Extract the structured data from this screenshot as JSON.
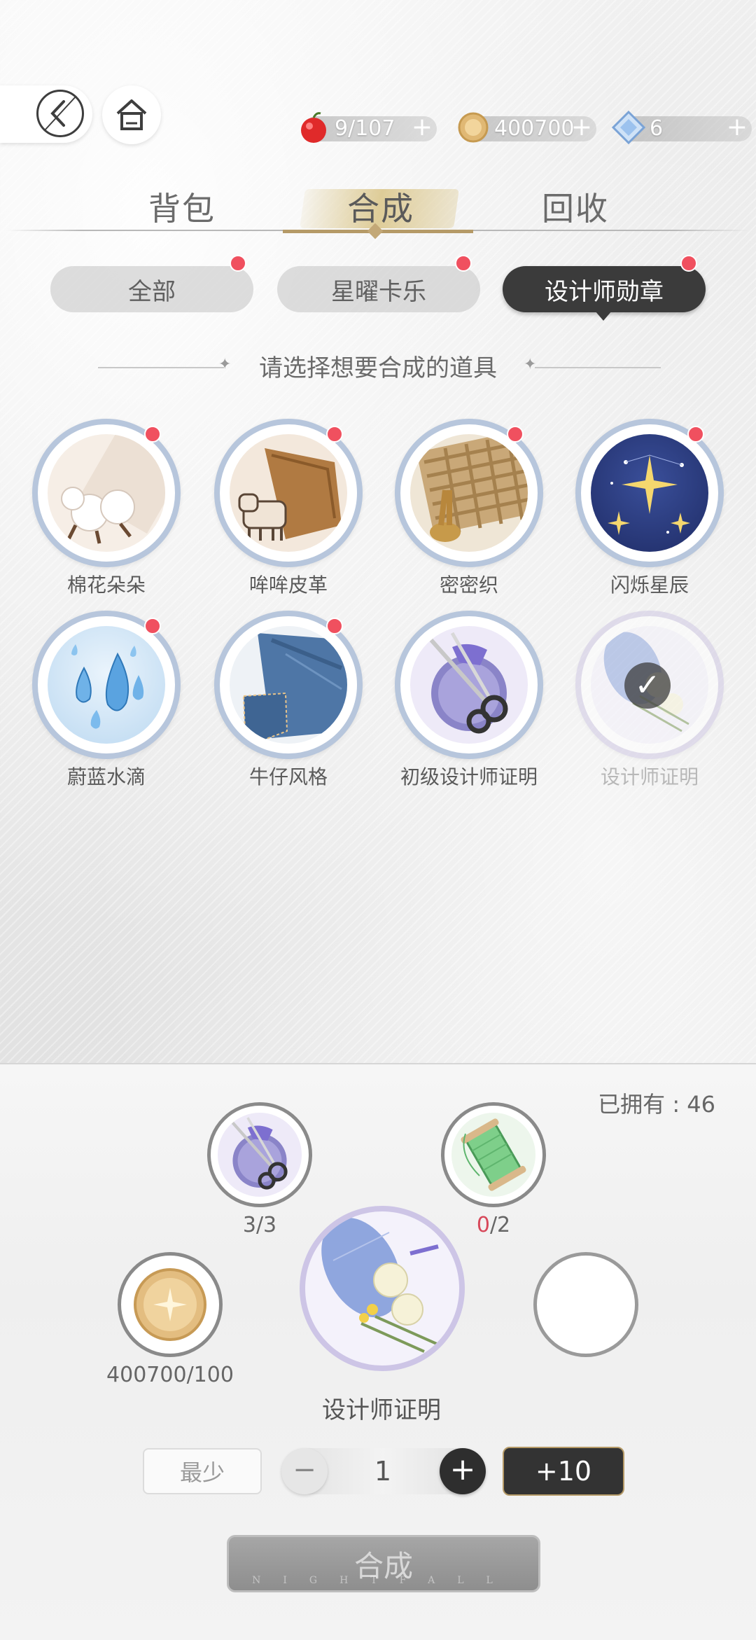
{
  "topbar": {
    "back_label": "",
    "resources": [
      {
        "name": "apple",
        "value": "9/107",
        "plus": "+"
      },
      {
        "name": "coin",
        "value": "400700",
        "plus": "+"
      },
      {
        "name": "diamond",
        "value": "6",
        "plus": "+"
      }
    ]
  },
  "tabs": [
    {
      "label": "背包",
      "active": false
    },
    {
      "label": "合成",
      "active": true
    },
    {
      "label": "回收",
      "active": false
    }
  ],
  "subtabs": [
    {
      "label": "全部",
      "active": false,
      "badge": true
    },
    {
      "label": "星曜卡乐",
      "active": false,
      "badge": true
    },
    {
      "label": "设计师勋章",
      "active": true,
      "badge": true
    }
  ],
  "prompt": "请选择想要合成的道具",
  "items": [
    {
      "label": "棉花朵朵",
      "icon": "cotton-icon",
      "badge": true,
      "selected": false
    },
    {
      "label": "哞哞皮革",
      "icon": "leather-icon",
      "badge": true,
      "selected": false
    },
    {
      "label": "密密织",
      "icon": "weave-icon",
      "badge": true,
      "selected": false
    },
    {
      "label": "闪烁星辰",
      "icon": "stars-icon",
      "badge": true,
      "selected": false
    },
    {
      "label": "蔚蓝水滴",
      "icon": "waterdrop-icon",
      "badge": true,
      "selected": false
    },
    {
      "label": "牛仔风格",
      "icon": "denim-icon",
      "badge": true,
      "selected": false
    },
    {
      "label": "初级设计师证明",
      "icon": "scissors-badge-icon",
      "badge": false,
      "selected": false
    },
    {
      "label": "设计师证明",
      "icon": "designer-badge-icon",
      "badge": false,
      "selected": true
    }
  ],
  "panel": {
    "owned": "已拥有 : 46",
    "materials": [
      {
        "name": "scissors-badge",
        "have": "3",
        "need": "/3",
        "short": false
      },
      {
        "name": "thread-spool",
        "have": "0",
        "need": "/2",
        "short": true
      },
      {
        "name": "coin",
        "have": "400700",
        "need": "/100",
        "short": false
      }
    ],
    "result_name": "设计师证明",
    "min_label": "最少",
    "minus": "−",
    "plus": "+",
    "quantity": "1",
    "plus10_label": "+10",
    "combine_label": "合成",
    "combine_watermark": "NIGHTFALL"
  },
  "colors": {
    "accent_gold": "#b59a67",
    "dark_button": "#333333",
    "badge_red": "#f0505f",
    "ring_blue": "#b7c6dc",
    "shortage_red": "#d7485a"
  }
}
